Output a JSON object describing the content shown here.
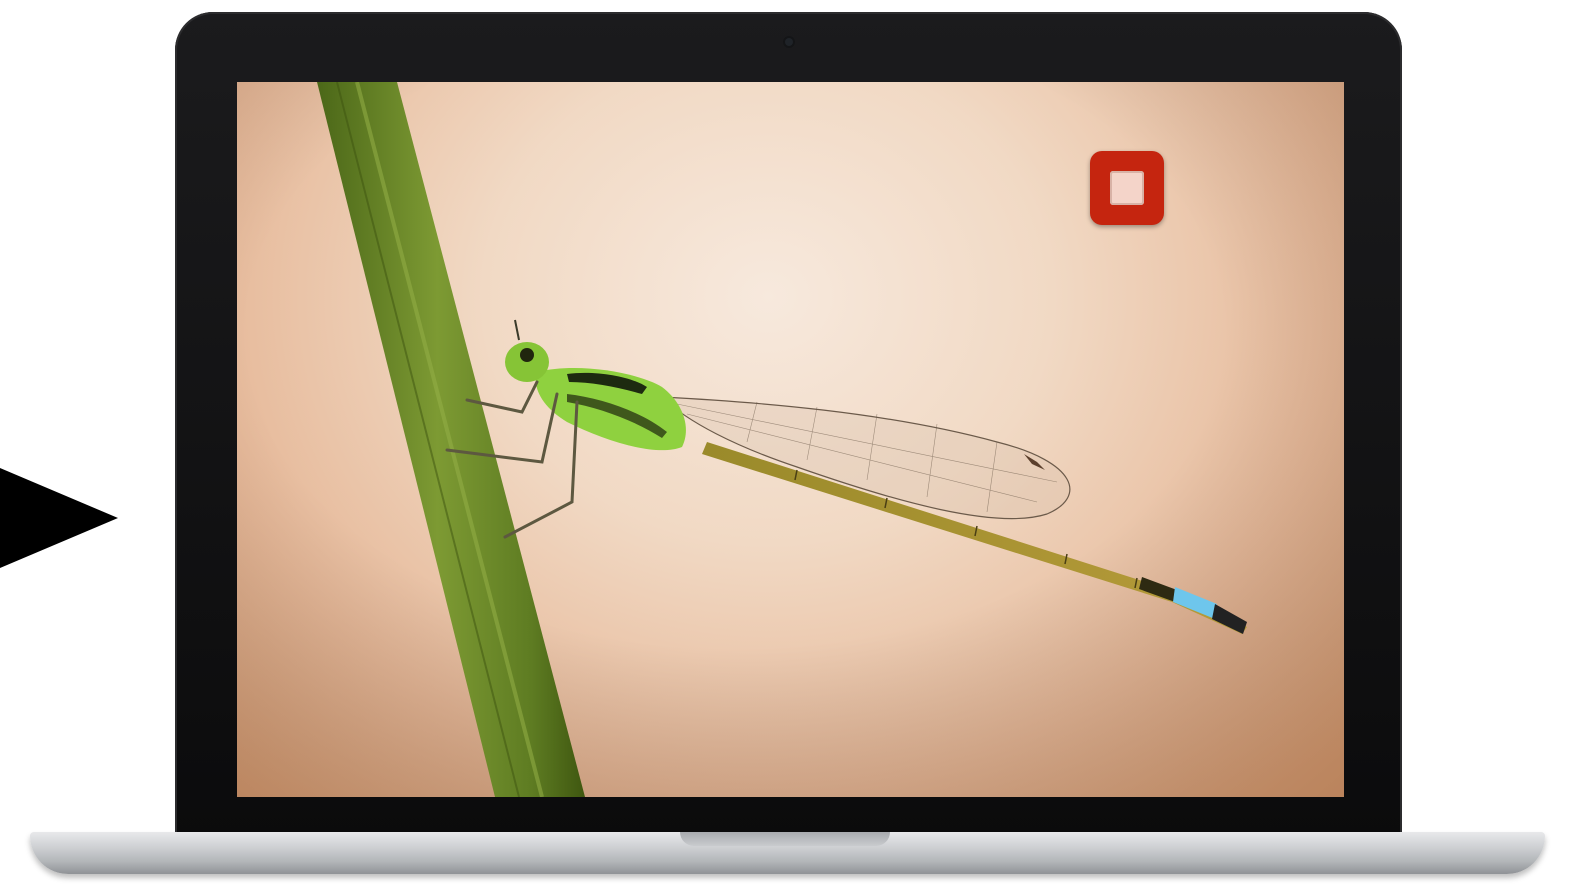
{
  "scene": {
    "device": "laptop",
    "left_indicator_icon": "play-arrow-icon"
  },
  "screen": {
    "content_type": "photo",
    "stop_button": {
      "icon": "stop-icon",
      "color": "#c5250f"
    }
  },
  "colors": {
    "bezel": "#0b0b0c",
    "background_warm": "#f1d9c4",
    "stem_green": "#5f7d24",
    "damselfly_green": "#8fd13f",
    "tail_blue": "#6ec6ec",
    "stop_red": "#c5250f"
  }
}
